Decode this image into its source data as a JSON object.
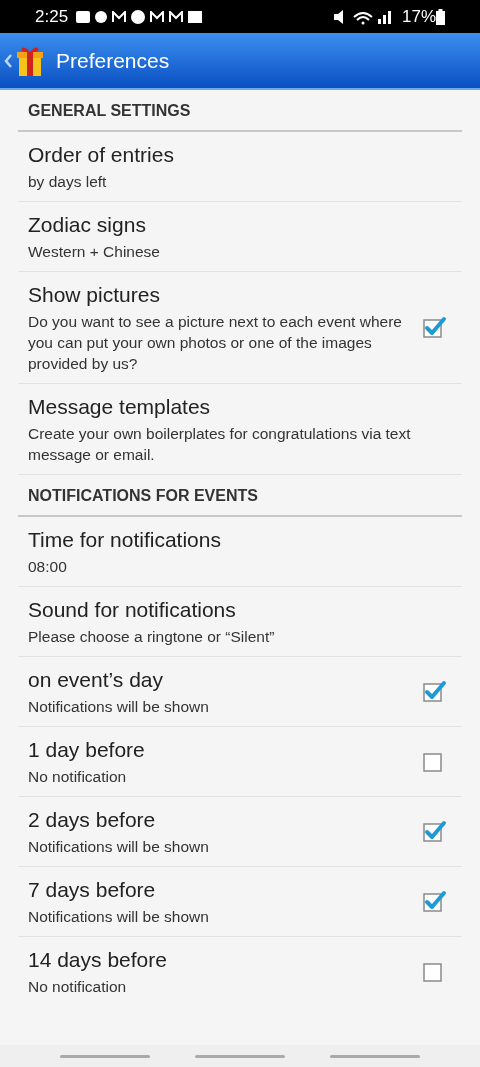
{
  "status_bar": {
    "time": "2:25",
    "battery": "17%"
  },
  "app_bar": {
    "title": "Preferences"
  },
  "sections": [
    {
      "title": "GENERAL SETTINGS",
      "items": [
        {
          "kind": "text",
          "title": "Order of entries",
          "summary": "by days left"
        },
        {
          "kind": "text",
          "title": "Zodiac signs",
          "summary": "Western + Chinese"
        },
        {
          "kind": "checkbox",
          "title": "Show pictures",
          "summary": "Do you want to see a picture next to each event where you can put your own photos or one of the images provided by us?",
          "checked": true
        },
        {
          "kind": "text",
          "title": "Message templates",
          "summary": "Create your own boilerplates for congratulations via text message or email."
        }
      ]
    },
    {
      "title": "NOTIFICATIONS FOR EVENTS",
      "items": [
        {
          "kind": "text",
          "title": "Time for notifications",
          "summary": "08:00"
        },
        {
          "kind": "text",
          "title": "Sound for notifications",
          "summary": "Please choose a ringtone or “Silent”"
        },
        {
          "kind": "checkbox",
          "title": "on event’s day",
          "summary": "Notifications will be shown",
          "checked": true
        },
        {
          "kind": "checkbox",
          "title": "1 day before",
          "summary": "No notification",
          "checked": false
        },
        {
          "kind": "checkbox",
          "title": "2 days before",
          "summary": "Notifications will be shown",
          "checked": true
        },
        {
          "kind": "checkbox",
          "title": "7 days before",
          "summary": "Notifications will be shown",
          "checked": true
        },
        {
          "kind": "checkbox",
          "title": "14 days before",
          "summary": "No notification",
          "checked": false
        }
      ]
    }
  ]
}
